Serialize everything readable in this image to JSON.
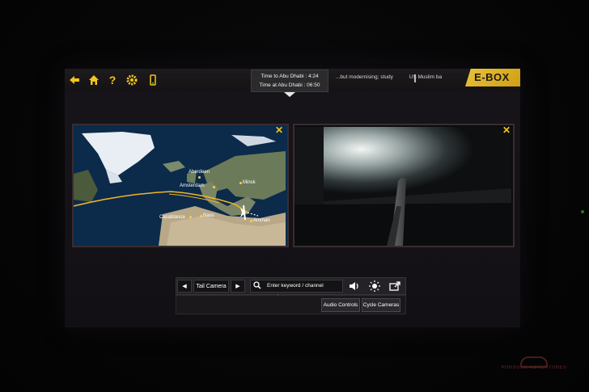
{
  "topbar": {
    "icons": [
      "back-arrow-icon",
      "home-icon",
      "help-icon",
      "settings-gear-icon",
      "phone-icon"
    ],
    "tooltip_time_to": "Time to Abu Dhabi : 4:24",
    "tooltip_time_at": "Time at Abu Dhabi : 06:50",
    "ticker_text": "...but modernising; study",
    "ticker_text_2": "US Muslim ba",
    "brand": "E-BOX"
  },
  "map_panel": {
    "cities": [
      "Aberdeen",
      "Amsterdam",
      "Minsk",
      "Casablanca",
      "Nass",
      "Amman"
    ],
    "close_label": "✕"
  },
  "camera_panel": {
    "close_label": "✕"
  },
  "controls": {
    "prev_label": "◀",
    "channel_name": "Tail Camera",
    "next_label": "▶",
    "search_placeholder": "Enter keyword / channel number",
    "audio_button": "Audio Controls",
    "cycle_button": "Cycle Cameras"
  },
  "watermark": {
    "text": "PURSUED ADVENTURES"
  },
  "colors": {
    "accent": "#f3c51a",
    "panel_border": "#3a2c30",
    "brand_bg": "#e0b52c"
  }
}
